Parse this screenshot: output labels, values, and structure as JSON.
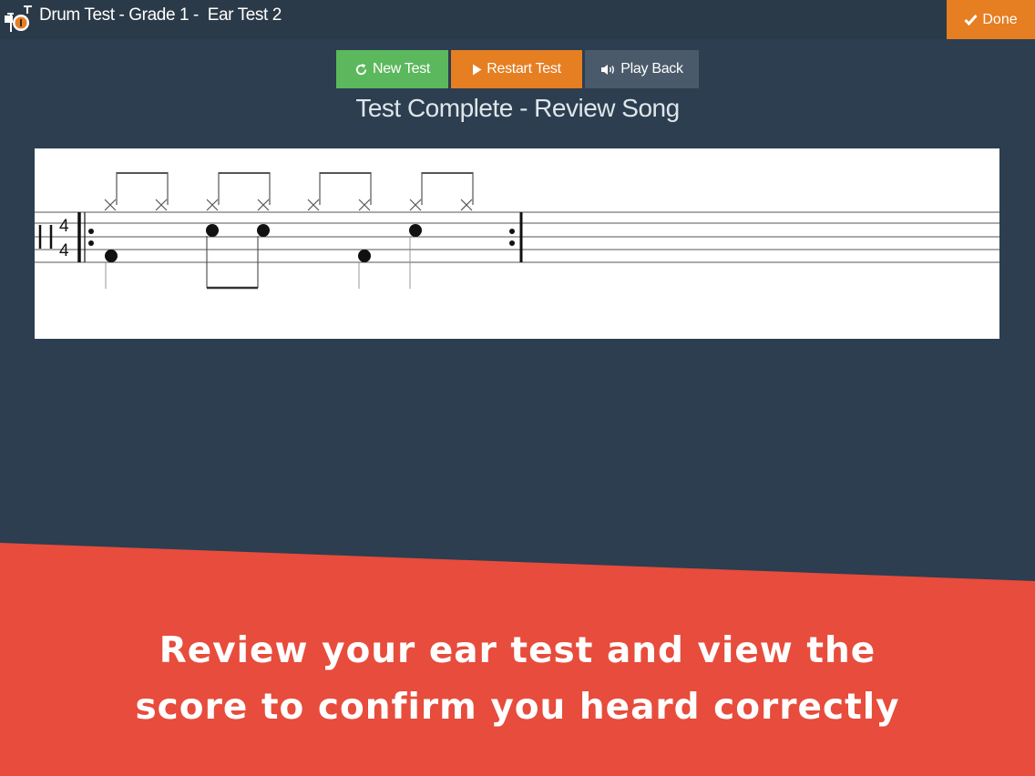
{
  "header": {
    "title": "Drum Test - Grade 1 -  Ear Test 2",
    "logo_icon": "drum-kit-icon",
    "done_label": "Done",
    "done_icon": "check-icon"
  },
  "toolbar": {
    "new_test_label": "New Test",
    "new_test_icon": "refresh-icon",
    "restart_label": "Restart Test",
    "restart_icon": "play-icon",
    "playback_label": "Play Back",
    "playback_icon": "speaker-icon"
  },
  "main": {
    "status_title": "Test Complete - Review Song"
  },
  "score": {
    "time_signature_top": "4",
    "time_signature_bottom": "4"
  },
  "banner": {
    "line1": "Review your ear test and view the",
    "line2": "score to confirm you heard correctly"
  },
  "colors": {
    "background": "#2c3e50",
    "green": "#5cb85c",
    "orange": "#e67e22",
    "slate": "#4a5a6a",
    "banner": "#e74c3c"
  }
}
